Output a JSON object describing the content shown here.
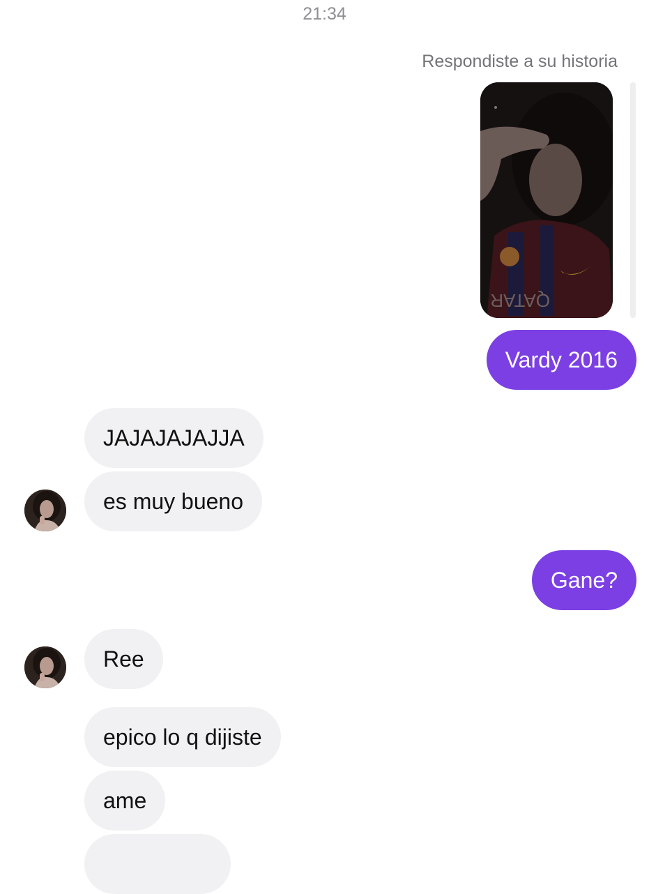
{
  "thread": {
    "timestamp": "21:34",
    "reply_note": "Respondiste a su historia"
  },
  "messages": [
    {
      "from": "me",
      "text": "Vardy 2016"
    },
    {
      "from": "them",
      "text": "JAJAJAJAJJA"
    },
    {
      "from": "them",
      "text": "es muy bueno"
    },
    {
      "from": "me",
      "text": "Gane?"
    },
    {
      "from": "them",
      "text": "Ree"
    },
    {
      "from": "them",
      "text": "epico lo q dijiste"
    },
    {
      "from": "them",
      "text": "ame"
    }
  ],
  "colors": {
    "outgoing_bubble": "#7b3fe4",
    "incoming_bubble": "#f1f1f3",
    "timestamp_text": "#8e8e93"
  },
  "icons": {
    "avatar": "contact-avatar",
    "story": "story-preview"
  }
}
